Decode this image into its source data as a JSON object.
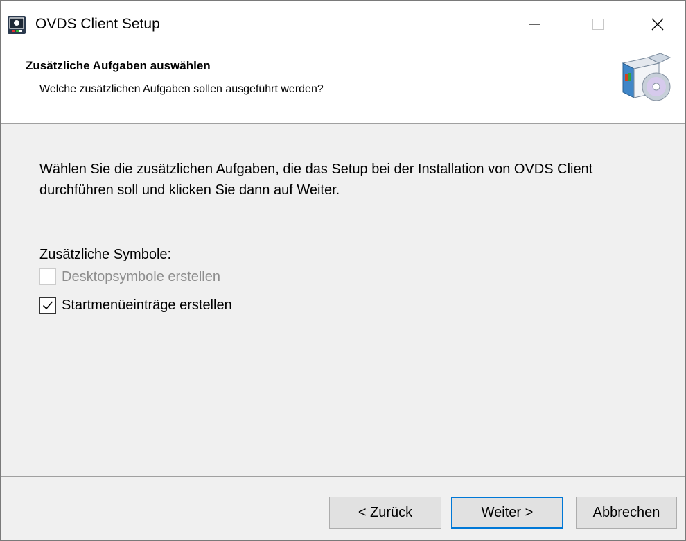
{
  "window": {
    "title": "OVDS Client Setup"
  },
  "header": {
    "title": "Zusätzliche Aufgaben auswählen",
    "subtitle": "Welche zusätzlichen Aufgaben sollen ausgeführt werden?"
  },
  "body": {
    "description": "Wählen Sie die zusätzlichen Aufgaben, die das Setup bei der Installation von OVDS Client durchführen soll und klicken Sie dann auf Weiter.",
    "group_label": "Zusätzliche Symbole:",
    "tasks": [
      {
        "label": "Desktopsymbole erstellen",
        "checked": false,
        "enabled": false
      },
      {
        "label": "Startmenüeinträge erstellen",
        "checked": true,
        "enabled": true
      }
    ]
  },
  "buttons": {
    "back": "< Zurück",
    "next": "Weiter >",
    "cancel": "Abbrechen"
  },
  "colors": {
    "accent": "#0078d7",
    "disabled_text": "#8d8d8d",
    "dialog_bg": "#f0f0f0"
  }
}
